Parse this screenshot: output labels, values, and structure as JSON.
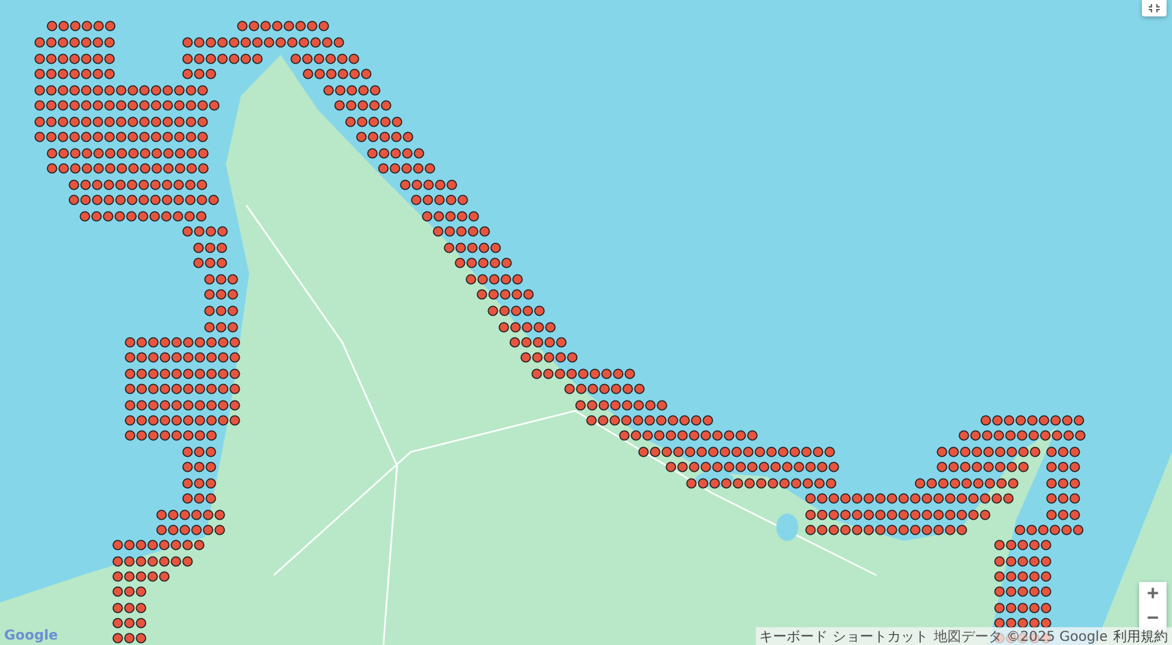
{
  "map": {
    "logo": "Google",
    "attribution": [
      {
        "kind": "link",
        "text": "キーボード ショートカット"
      },
      {
        "kind": "text",
        "text": "地図データ ©2025 Google"
      },
      {
        "kind": "link",
        "text": "利用規約"
      }
    ]
  },
  "controls": {
    "zoom_in": "+",
    "zoom_out": "−"
  }
}
